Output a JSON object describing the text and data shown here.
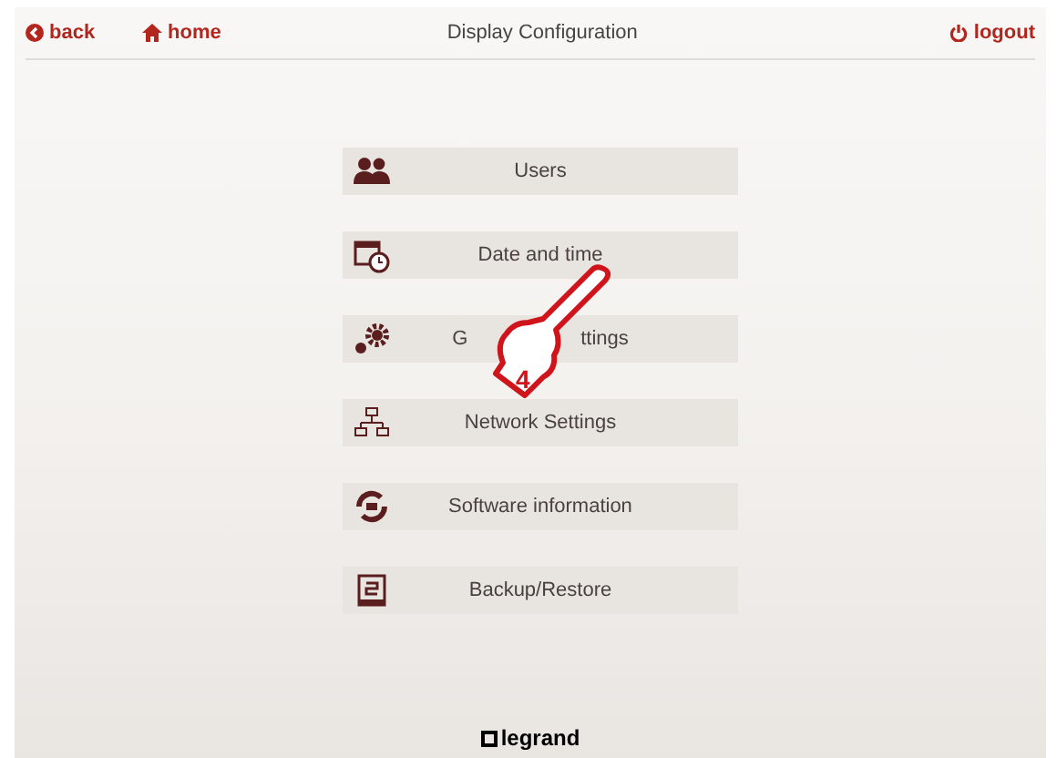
{
  "header": {
    "back": "back",
    "home": "home",
    "title": "Display Configuration",
    "logout": "logout"
  },
  "menu": [
    {
      "kind": "users",
      "label_parts": [
        "Users"
      ]
    },
    {
      "kind": "calendar",
      "label_parts": [
        "Date and time"
      ]
    },
    {
      "kind": "gears",
      "label_parts": [
        "G",
        "ttings"
      ]
    },
    {
      "kind": "network",
      "label_parts": [
        "Network Settings"
      ]
    },
    {
      "kind": "software",
      "label_parts": [
        "Software information"
      ]
    },
    {
      "kind": "backup",
      "label_parts": [
        "Backup/Restore"
      ]
    }
  ],
  "callout": {
    "step": "4"
  },
  "footer": {
    "logo": "legrand"
  }
}
